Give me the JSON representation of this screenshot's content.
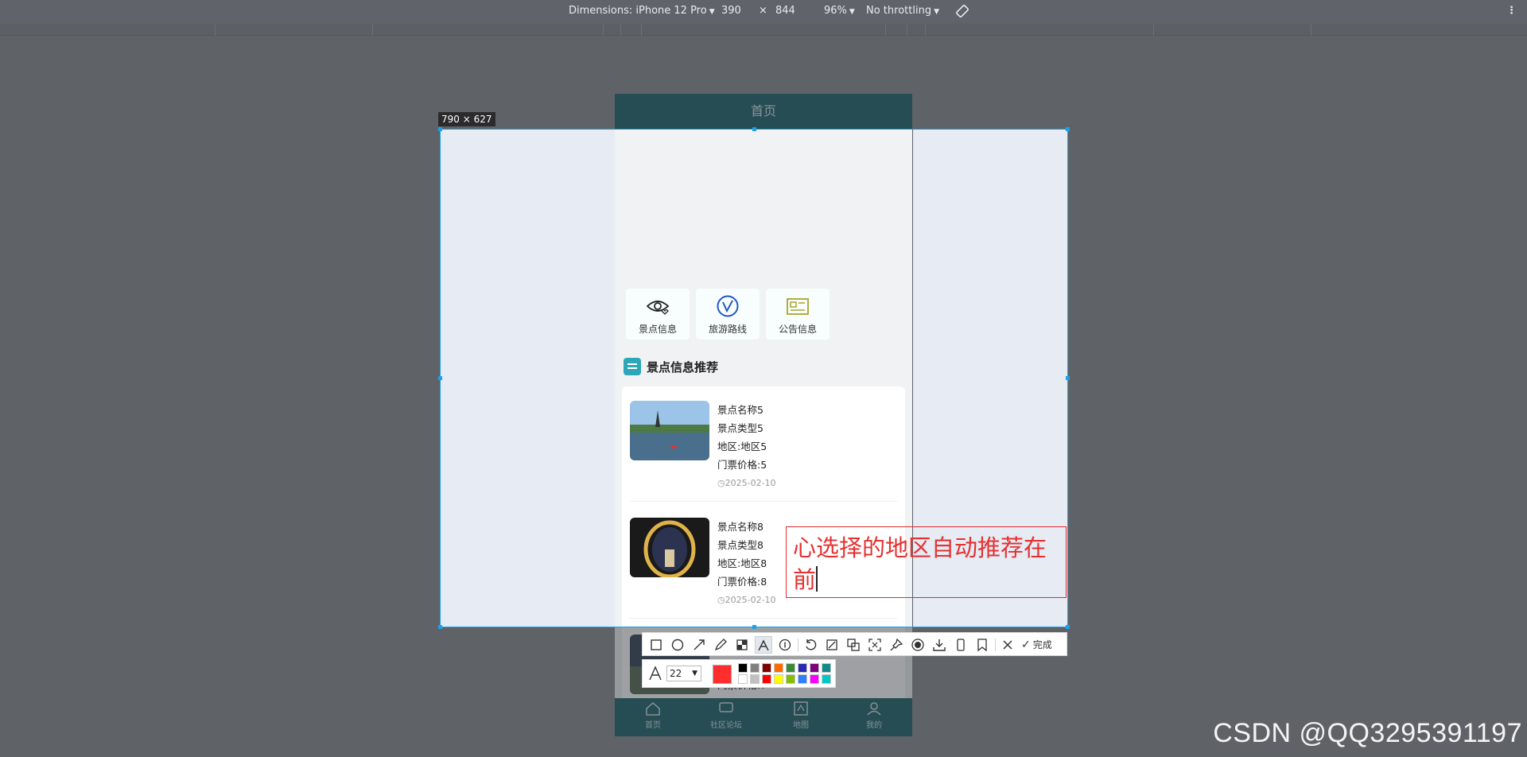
{
  "devtools": {
    "dimensions_label": "Dimensions: iPhone 12 Pro",
    "width": "390",
    "times": "×",
    "height": "844",
    "zoom": "96%",
    "throttling": "No throttling"
  },
  "phone": {
    "header_title": "首页",
    "quick_links": [
      {
        "label": "景点信息",
        "icon": "eye-heart-icon"
      },
      {
        "label": "旅游路线",
        "icon": "route-icon"
      },
      {
        "label": "公告信息",
        "icon": "notice-icon"
      }
    ],
    "section_title": "景点信息推荐",
    "items": [
      {
        "name": "景点名称5",
        "type": "景点类型5",
        "region": "地区:地区5",
        "price": "门票价格:5",
        "date": "2025-02-10"
      },
      {
        "name": "景点名称8",
        "type": "景点类型8",
        "region": "地区:地区8",
        "price": "门票价格:8",
        "date": "2025-02-10"
      },
      {
        "name": "",
        "type": "",
        "region": "",
        "price": "门票价格:7",
        "date": ""
      }
    ],
    "nav": [
      {
        "label": "首页",
        "icon": "home-icon"
      },
      {
        "label": "社区论坛",
        "icon": "forum-icon"
      },
      {
        "label": "地图",
        "icon": "map-icon"
      },
      {
        "label": "我的",
        "icon": "user-icon"
      }
    ]
  },
  "capture": {
    "size_label": "790 × 627",
    "annotation_line1": "心选择的地区自动推荐在",
    "annotation_line2": "前",
    "done_label": "完成",
    "font_size": "22",
    "current_color": "#ff2d2d",
    "palette": [
      "#000000",
      "#808080",
      "#800000",
      "#ff6a00",
      "#3a8a3a",
      "#2a2ab0",
      "#800080",
      "#0f8a8a",
      "#ffffff",
      "#c0c0c0",
      "#ff0000",
      "#ffff00",
      "#80c000",
      "#2f7fff",
      "#ff00ff",
      "#00c8c8"
    ]
  },
  "watermark": "CSDN @QQ3295391197"
}
